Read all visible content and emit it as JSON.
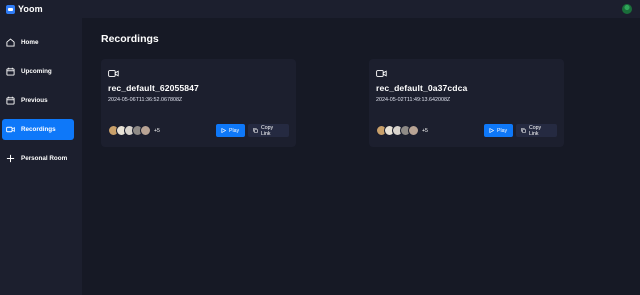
{
  "app": {
    "name": "Yoom"
  },
  "sidebar": {
    "items": [
      {
        "label": "Home",
        "icon": "home-icon",
        "active": false
      },
      {
        "label": "Upcoming",
        "icon": "calendar-icon",
        "active": false
      },
      {
        "label": "Previous",
        "icon": "calendar-icon",
        "active": false
      },
      {
        "label": "Recordings",
        "icon": "video-icon",
        "active": true
      },
      {
        "label": "Personal Room",
        "icon": "plus-icon",
        "active": false
      }
    ]
  },
  "main": {
    "title": "Recordings",
    "recordings": [
      {
        "title": "rec_default_62055847",
        "date": "2024-05-06T11:36:52.067808Z",
        "more_count": "+5",
        "play_label": "Play",
        "copy_label": "Copy Link"
      },
      {
        "title": "rec_default_0a37cdca",
        "date": "2024-05-02T11:49:13.642008Z",
        "more_count": "+5",
        "play_label": "Play",
        "copy_label": "Copy Link"
      }
    ]
  },
  "colors": {
    "background": "#161925",
    "panel": "#1c1f2e",
    "accent": "#0e78f9",
    "secondary_button": "#252a41"
  }
}
